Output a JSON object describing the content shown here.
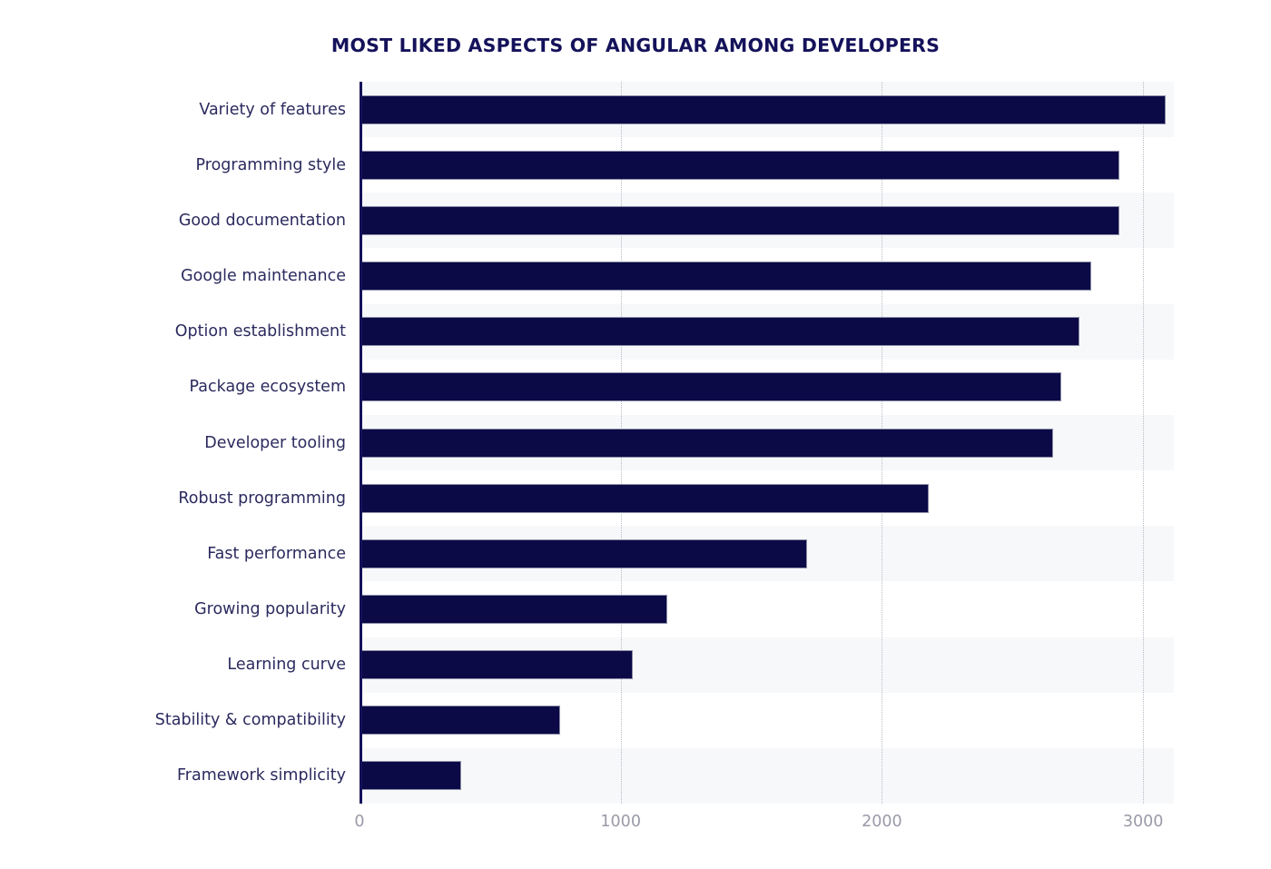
{
  "chart_data": {
    "type": "bar",
    "orientation": "horizontal",
    "title": "MOST LIKED ASPECTS OF ANGULAR AMONG DEVELOPERS",
    "xlabel": "",
    "ylabel": "",
    "categories": [
      "Variety of features",
      "Programming style",
      "Good documentation",
      "Google maintenance",
      "Option establishment",
      "Package ecosystem",
      "Developer tooling",
      "Robust programming",
      "Fast performance",
      "Growing popularity",
      "Learning curve",
      "Stability & compatibility",
      "Framework simplicity"
    ],
    "values": [
      3086,
      2909,
      2909,
      2800,
      2757,
      2687,
      2655,
      2179,
      1712,
      1180,
      1045,
      767,
      389
    ],
    "xlim": [
      0,
      3100
    ],
    "xticks": [
      0,
      1000,
      2000,
      3000
    ],
    "xtick_labels": [
      "0",
      "1000",
      "2000",
      "3000"
    ],
    "grid": "vertical-dotted",
    "legend": "none",
    "bar_color": "#0b0a47",
    "band_color": "#f7f8fa",
    "title_color": "#14125a",
    "label_color": "#2b2a5e",
    "tick_color": "#9a9aa8"
  }
}
